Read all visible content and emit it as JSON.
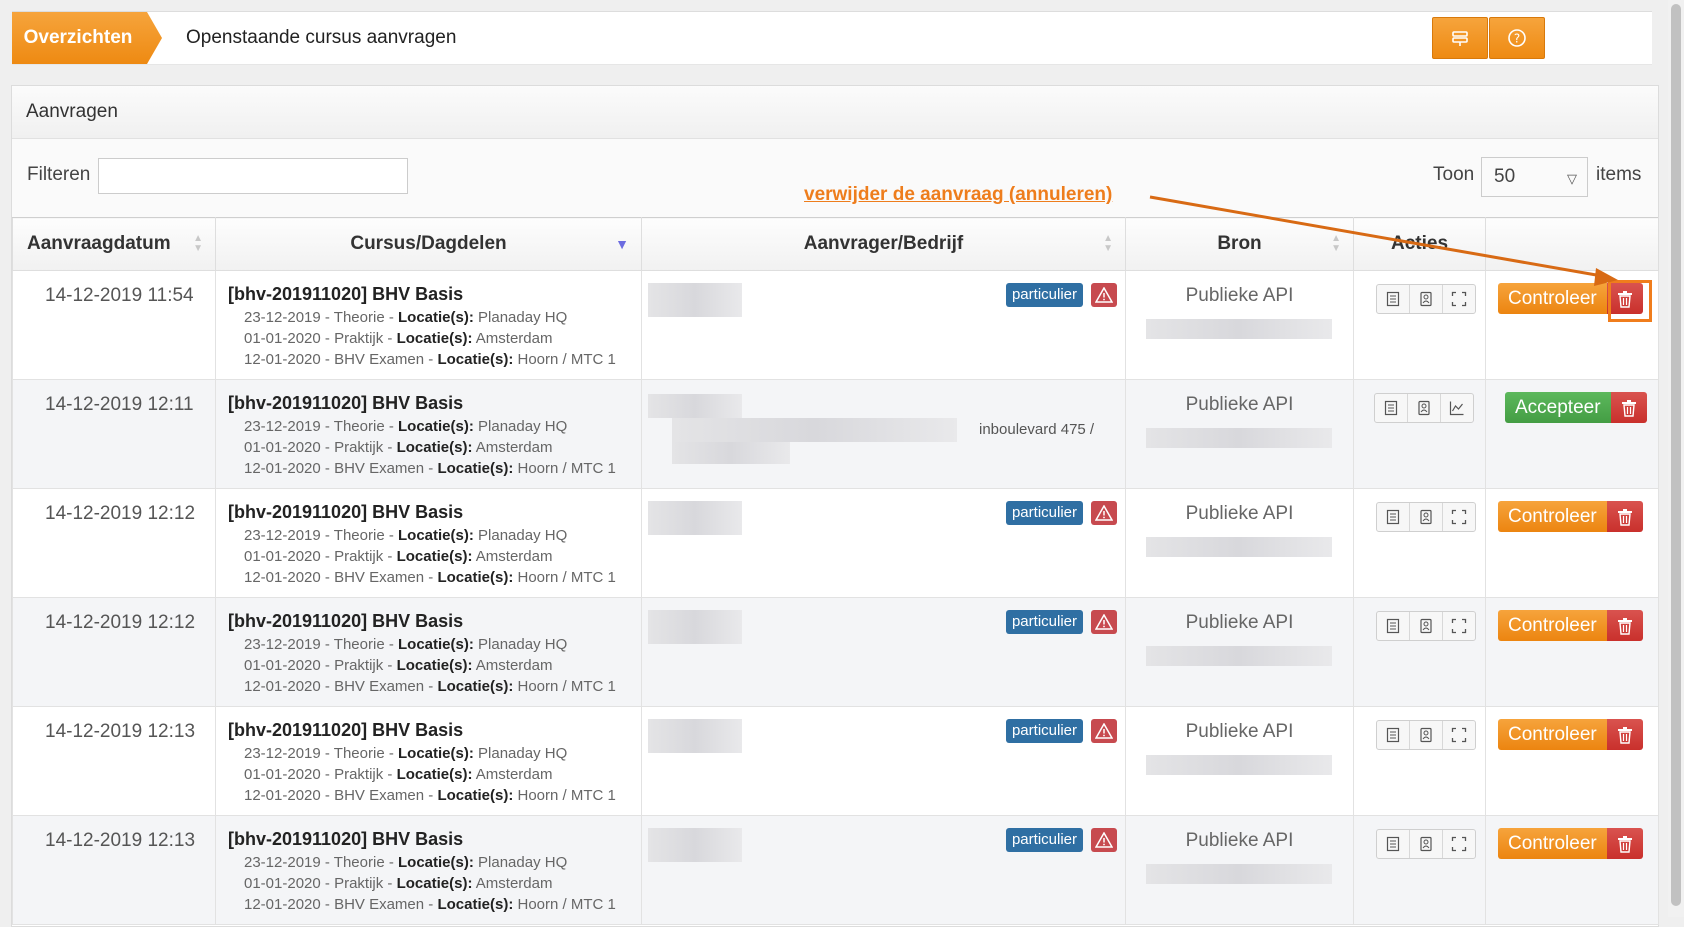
{
  "breadcrumb": {
    "section": "Overzichten",
    "title": "Openstaande cursus aanvragen"
  },
  "toolbar": {
    "buttons": [
      "signpost-icon",
      "help-icon"
    ]
  },
  "panel": {
    "title": "Aanvragen"
  },
  "filter": {
    "label": "Filteren",
    "value": ""
  },
  "pagesize": {
    "label_before": "Toon",
    "value": "50",
    "label_after": "items"
  },
  "annotation": {
    "text": "verwijder de aanvraag (annuleren)"
  },
  "table": {
    "headers": [
      "Aanvraagdatum",
      "Cursus/Dagdelen",
      "Aanvrager/Bedrijf",
      "Bron",
      "Acties",
      ""
    ],
    "rows": [
      {
        "date": "14-12-2019 11:54",
        "course": "[bhv-201911020] BHV Basis",
        "badge": "particulier",
        "source": "Publieke API",
        "action": "Controleer",
        "action_type": "check"
      },
      {
        "date": "14-12-2019 12:11",
        "course": "[bhv-201911020] BHV Basis",
        "badge": "",
        "address": "inboulevard 475 /",
        "source": "Publieke API",
        "action": "Accepteer",
        "action_type": "accept"
      },
      {
        "date": "14-12-2019 12:12",
        "course": "[bhv-201911020] BHV Basis",
        "badge": "particulier",
        "source": "Publieke API",
        "action": "Controleer",
        "action_type": "check"
      },
      {
        "date": "14-12-2019 12:12",
        "course": "[bhv-201911020] BHV Basis",
        "badge": "particulier",
        "source": "Publieke API",
        "action": "Controleer",
        "action_type": "check"
      },
      {
        "date": "14-12-2019 12:13",
        "course": "[bhv-201911020] BHV Basis",
        "badge": "particulier",
        "source": "Publieke API",
        "action": "Controleer",
        "action_type": "check"
      },
      {
        "date": "14-12-2019 12:13",
        "course": "[bhv-201911020] BHV Basis",
        "badge": "particulier",
        "source": "Publieke API",
        "action": "Controleer",
        "action_type": "check"
      }
    ],
    "sessions": [
      {
        "date": "23-12-2019",
        "type": "Theorie",
        "loc_label": "Locatie(s):",
        "location": "Planaday HQ"
      },
      {
        "date": "01-01-2020",
        "type": "Praktijk",
        "loc_label": "Locatie(s):",
        "location": "Amsterdam"
      },
      {
        "date": "12-01-2020",
        "type": "BHV Examen",
        "loc_label": "Locatie(s):",
        "location": "Hoorn / MTC 1"
      }
    ]
  },
  "colors": {
    "accent": "#f0901e",
    "danger": "#d9534f",
    "success": "#4cae4c",
    "badge": "#2f6fa3"
  }
}
